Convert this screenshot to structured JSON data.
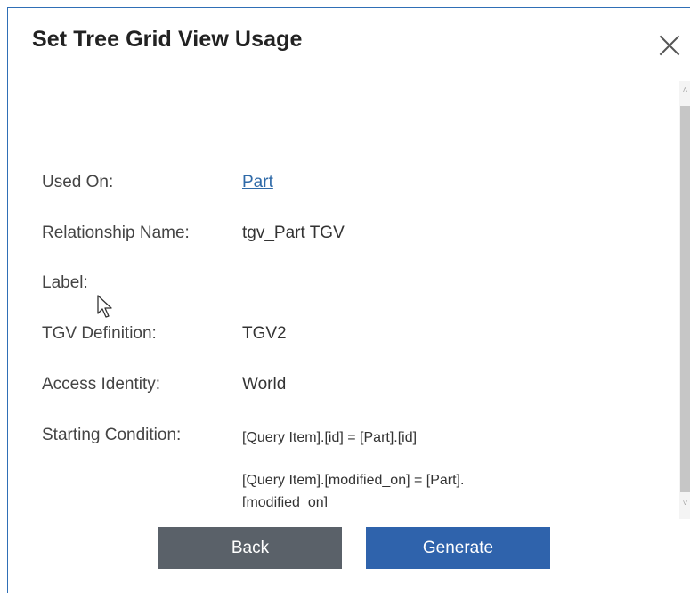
{
  "dialog": {
    "title": "Set Tree Grid View Usage"
  },
  "fields": {
    "used_on_label": "Used On:",
    "used_on_value": "Part",
    "relationship_name_label": "Relationship Name:",
    "relationship_name_value": "tgv_Part TGV",
    "label_label": "Label:",
    "label_value": "",
    "tgv_definition_label": "TGV Definition:",
    "tgv_definition_value": "TGV2",
    "access_identity_label": "Access Identity:",
    "access_identity_value": "World",
    "starting_condition_label": "Starting Condition:",
    "starting_conditions": [
      "[Query Item].[id] = [Part].[id]",
      "[Query Item].[modified_on] = [Part].",
      "[modified_on]"
    ]
  },
  "buttons": {
    "back": "Back",
    "generate": "Generate"
  },
  "icons": {
    "close": "close-icon",
    "cursor": "mouse-pointer-icon"
  },
  "colors": {
    "link": "#2f6aa8",
    "back_button": "#5a6169",
    "generate_button": "#2f63ac",
    "border": "#2f6fb6"
  }
}
